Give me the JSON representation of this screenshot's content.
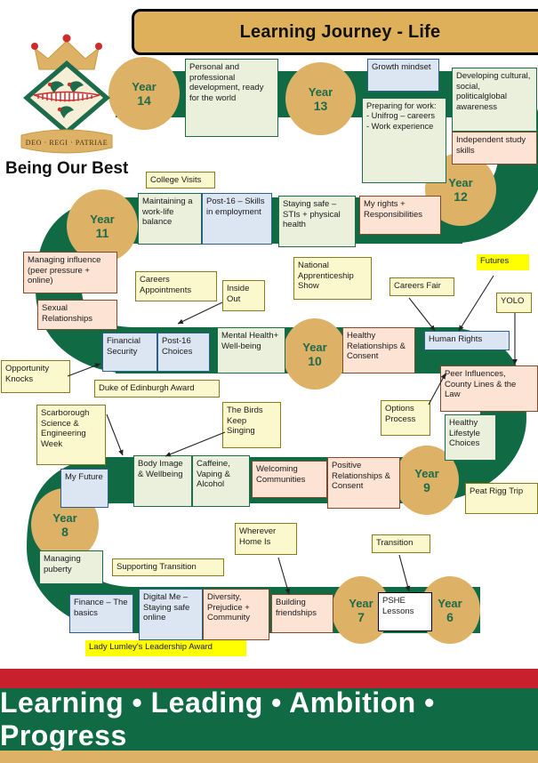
{
  "header": {
    "title": "Learning Journey - Life",
    "motto": "Being Our Best"
  },
  "crest": {
    "name": "school-crest",
    "scroll_text": "DEO · REGI · PATRIAE"
  },
  "footer": {
    "strapline": "Learning • Leading • Ambition • Progress",
    "bar_colors": {
      "red": "#c8202c",
      "green": "#106b44",
      "gold": "#ddb166"
    }
  },
  "palette": {
    "path_green": "#106b44",
    "circle_gold": "#ddb166",
    "box_green_fill": "#eaf0dc",
    "box_blue_fill": "#dce6f2",
    "box_peach_fill": "#fce3d4",
    "box_cream_fill": "#fcf8cd",
    "highlight_yellow": "#ffff00",
    "year_text_green": "#1d6b4a"
  },
  "years": [
    {
      "id": "year-14",
      "word": "Year",
      "num": "14"
    },
    {
      "id": "year-13",
      "word": "Year",
      "num": "13"
    },
    {
      "id": "year-12",
      "word": "Year",
      "num": "12"
    },
    {
      "id": "year-11",
      "word": "Year",
      "num": "11"
    },
    {
      "id": "year-10",
      "word": "Year",
      "num": "10"
    },
    {
      "id": "year-9",
      "word": "Year",
      "num": "9"
    },
    {
      "id": "year-8",
      "word": "Year",
      "num": "8"
    },
    {
      "id": "year-7",
      "word": "Year",
      "num": "7"
    },
    {
      "id": "year-6",
      "word": "Year",
      "num": "6"
    }
  ],
  "boxes": {
    "personal_professional": "Personal and professional development, ready for the world",
    "growth_mindset": "Growth mindset",
    "preparing_for_work": "Preparing for work:\n-   Unifrog – careers\n-   Work experience",
    "developing_cultural": "Developing cultural, social, politicalglobal awareness",
    "independent_study": "Independent study skills",
    "college_visits": "College Visits",
    "maintaining_work_life": "Maintaining a work-life balance",
    "post16_skills": "Post-16 – Skills in employment",
    "staying_safe": "Staying safe – STIs + physical health",
    "my_rights": "My rights + Responsibilities",
    "managing_influence": "Managing influence (peer pressure + online)",
    "sexual_relationships": "Sexual Relationships",
    "careers_appointments": "Careers Appointments",
    "inside_out": "Inside Out",
    "national_apprenticeship": "National Apprenticeship Show",
    "careers_fair": "Careers Fair",
    "futures": "Futures",
    "yolo": "YOLO",
    "opportunity_knocks": "Opportunity Knocks",
    "financial_security": "Financial Security",
    "post16_choices": "Post-16 Choices",
    "mental_health": "Mental Health+ Well-being",
    "healthy_relationships": "Healthy Relationships & Consent",
    "human_rights": "Human Rights",
    "peer_influences": "Peer Influences, County Lines & the Law",
    "duke_of_edinburgh": "Duke of Edinburgh Award",
    "options_process": "Options Process",
    "healthy_lifestyle": "Healthy Lifestyle Choices",
    "scarborough_week": "Scarborough Science & Engineering Week",
    "birds_keep_singing": "The Birds Keep Singing",
    "my_future": "My Future",
    "body_image": "Body Image & Wellbeing",
    "caffeine_vaping": "Caffeine, Vaping & Alcohol",
    "welcoming_communities": "Welcoming Communities",
    "positive_relationships": "Positive Relationships & Consent",
    "peat_rigg": "Peat Rigg Trip",
    "managing_puberty": "Managing puberty",
    "supporting_transition": "Supporting Transition",
    "wherever_home_is": "Wherever Home Is",
    "transition": "Transition",
    "finance_basics": "Finance – The basics",
    "digital_me": "Digital Me – Staying safe online",
    "diversity_prejudice": "Diversity, Prejudice + Community",
    "building_friendships": "Building friendships",
    "pshe_lessons": "PSHE Lessons",
    "lady_lumley_award": "Lady Lumley's Leadership Award"
  }
}
